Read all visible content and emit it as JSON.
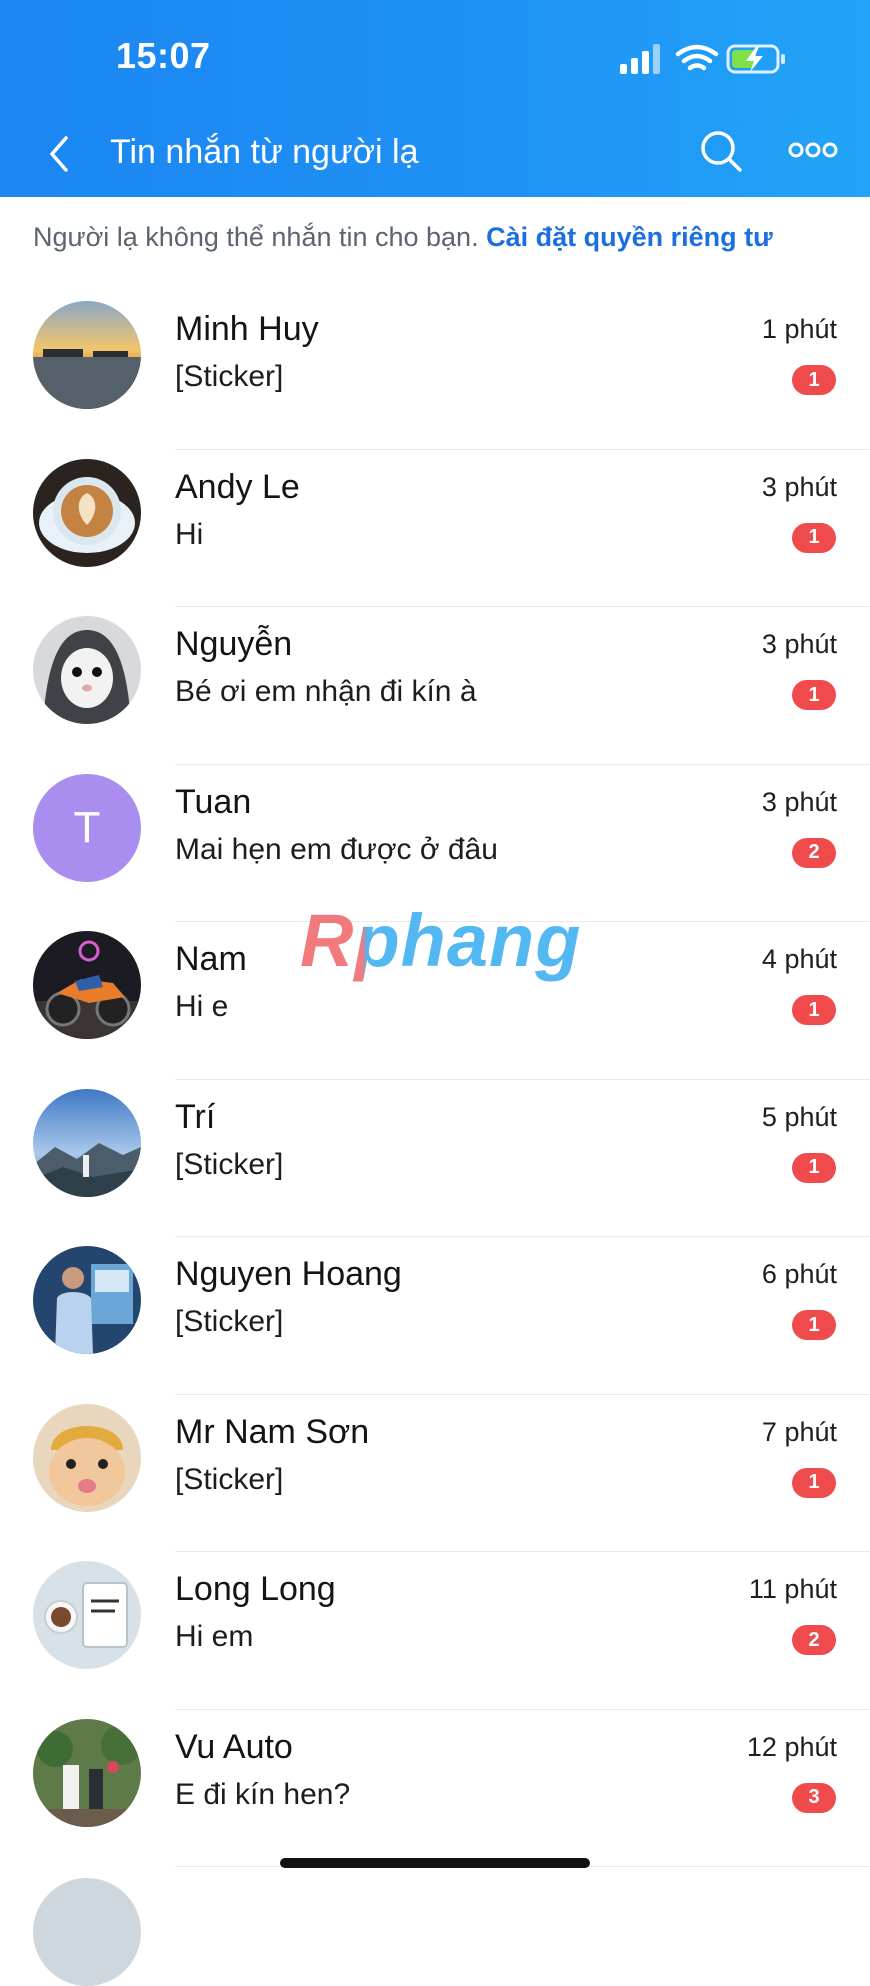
{
  "status_bar": {
    "time": "15:07"
  },
  "nav": {
    "title": "Tin nhắn từ người lạ"
  },
  "notice": {
    "text": "Người lạ không thể nhắn tin cho bạn.",
    "link": "Cài đặt quyền riêng tư"
  },
  "watermark": "Rphang",
  "colors": {
    "header": "#1e8ff4",
    "badge": "#ef4a4c",
    "link": "#1c6fe0",
    "avatar_t": "#a98ef0"
  },
  "conversations": [
    {
      "name": "Minh Huy",
      "preview": "[Sticker]",
      "time": "1 phút",
      "unread": "1",
      "avatar": "sunset-harbor-photo"
    },
    {
      "name": "Andy Le",
      "preview": "Hi",
      "time": "3 phút",
      "unread": "1",
      "avatar": "latte-art-photo"
    },
    {
      "name": "Nguyễn",
      "preview": "Bé ơi em nhận đi kín à",
      "time": "3 phút",
      "unread": "1",
      "avatar": "hooded-mouse-photo"
    },
    {
      "name": "Tuan",
      "preview": "Mai hẹn em được ở đâu",
      "time": "3 phút",
      "unread": "2",
      "avatar_letter": "T"
    },
    {
      "name": "Nam",
      "preview": "Hi e",
      "time": "4 phút",
      "unread": "1",
      "avatar": "motorbike-night-photo"
    },
    {
      "name": "Trí",
      "preview": "[Sticker]",
      "time": "5 phút",
      "unread": "1",
      "avatar": "mountain-sky-photo"
    },
    {
      "name": "Nguyen Hoang",
      "preview": "[Sticker]",
      "time": "6 phút",
      "unread": "1",
      "avatar": "person-blue-photo"
    },
    {
      "name": "Mr Nam Sơn",
      "preview": "[Sticker]",
      "time": "7 phút",
      "unread": "1",
      "avatar": "cat-hat-photo"
    },
    {
      "name": "Long Long",
      "preview": "Hi em",
      "time": "11 phút",
      "unread": "2",
      "avatar": "coffee-notebook-photo"
    },
    {
      "name": "Vu Auto",
      "preview": "E đi kín hen?",
      "time": "12 phút",
      "unread": "3",
      "avatar": "garden-couple-photo"
    }
  ]
}
